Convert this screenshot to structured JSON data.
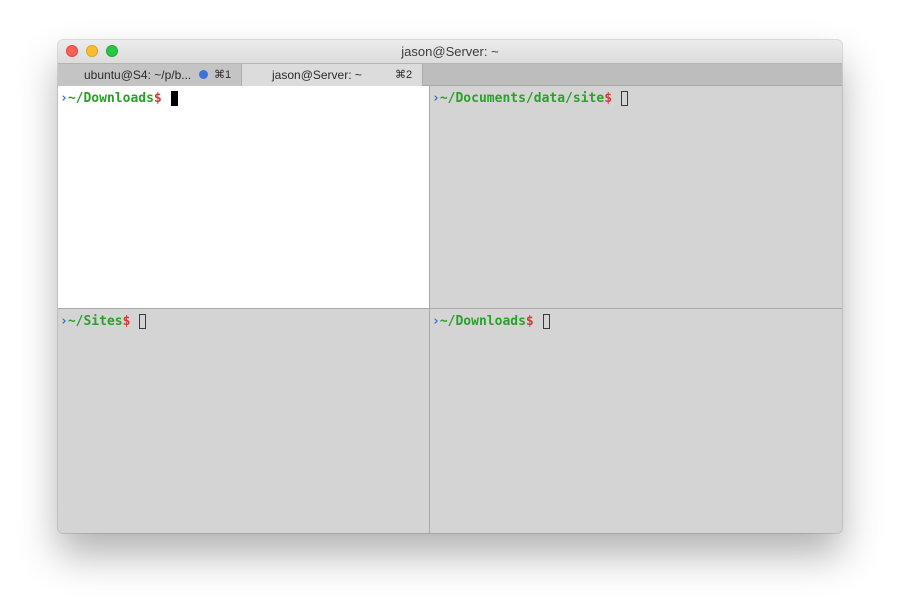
{
  "window": {
    "title": "jason@Server: ~"
  },
  "tabs": [
    {
      "label": "ubuntu@S4: ~/p/b...",
      "shortcut": "⌘1",
      "indicator_color": "#3b73d6"
    },
    {
      "label": "jason@Server: ~",
      "shortcut": "⌘2"
    }
  ],
  "panes": [
    {
      "chevron": "›",
      "path": "~/Downloads",
      "symbol": "$",
      "cursor": "active"
    },
    {
      "chevron": "›",
      "path": "~/Documents/data/site",
      "symbol": "$",
      "cursor": "inactive"
    },
    {
      "chevron": "›",
      "path": "~/Sites",
      "symbol": "$",
      "cursor": "inactive"
    },
    {
      "chevron": "›",
      "path": "~/Downloads",
      "symbol": "$",
      "cursor": "inactive"
    }
  ],
  "colors": {
    "path": "#2aa12a",
    "dollar": "#d23b3b",
    "chevron": "#2f6fd6",
    "active_pane_bg": "#ffffff",
    "inactive_pane_bg": "#d4d4d4"
  }
}
